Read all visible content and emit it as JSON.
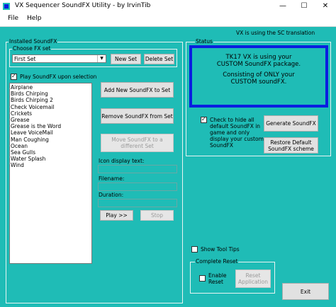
{
  "window": {
    "title": "VX Sequencer SoundFX Utility - by IrvinTib",
    "minimize": "—",
    "maximize": "☐",
    "close": "✕"
  },
  "menu": {
    "file": "File",
    "help": "Help"
  },
  "installed": {
    "group_label": "Installed SoundFX",
    "choose_label": "Choose FX set",
    "selected_set": "First Set",
    "new_set": "New Set",
    "delete_set": "Delete Set",
    "play_on_select": "Play SoundFX upon selection",
    "items": [
      "Airplane",
      "Birds Chirping",
      "Birds Chirping 2",
      "Check Voicemail",
      "Crickets",
      "Grease",
      "Grease is the Word",
      "Leave VoiceMail",
      "Man Coughing",
      "Ocean",
      "Sea Gulls",
      "Water Splash",
      "Wind"
    ],
    "add_new": "Add New SoundFX to Set",
    "remove": "Remove SoundFX from Set",
    "move_line1": "Move SoundFX to a",
    "move_line2": "different Set",
    "icon_text_label": "Icon display text:",
    "filename_label": "Filename:",
    "duration_label": "Duration:",
    "play": "Play >>",
    "stop": "Stop"
  },
  "status": {
    "top_note": "VX is using the SC translation",
    "group_label": "Status",
    "msg_line1": "TK17 VX is using your",
    "msg_line2": "CUSTOM SoundFX package.",
    "msg_line3": "Consisting of ONLY your",
    "msg_line4": "CUSTOM soundFX.",
    "hide_default_lines": [
      "Check to hide all",
      "default SoundFX in",
      "game and only",
      "display your custom",
      "SoundFX"
    ],
    "generate": "Generate SoundFX",
    "restore_line1": "Restore Default",
    "restore_line2": "SoundFX scheme"
  },
  "show_tooltips": "Show Tool Tips",
  "reset": {
    "group_label": "Complete Reset",
    "enable_line1": "Enable",
    "enable_line2": "Reset",
    "reset_line1": "Reset",
    "reset_line2": "Application"
  },
  "exit": "Exit",
  "colors": {
    "client_bg": "#1fbcb6",
    "status_border": "#0a1ee0"
  }
}
